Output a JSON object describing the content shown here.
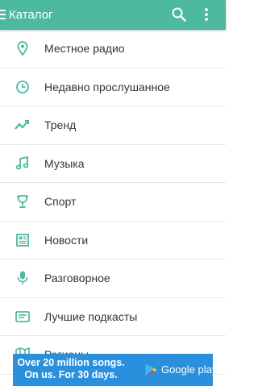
{
  "appbar": {
    "title": "Каталог",
    "icons": [
      "menu-icon",
      "search-icon",
      "more-vertical-icon"
    ],
    "color": "#4cb9a0"
  },
  "catalog": {
    "icon_color": "#4cb9a0",
    "items": [
      {
        "label": "Местное радио",
        "icon": "location-pin-icon"
      },
      {
        "label": "Недавно прослушанное",
        "icon": "clock-icon"
      },
      {
        "label": "Тренд",
        "icon": "trending-icon"
      },
      {
        "label": "Музыка",
        "icon": "music-note-icon"
      },
      {
        "label": "Спорт",
        "icon": "trophy-icon"
      },
      {
        "label": "Новости",
        "icon": "newspaper-icon"
      },
      {
        "label": "Разговорное",
        "icon": "microphone-icon"
      },
      {
        "label": "Лучшие подкасты",
        "icon": "podcast-icon"
      },
      {
        "label": "Регионы",
        "icon": "map-icon"
      }
    ]
  },
  "ad": {
    "line1": "Over 20 million songs.",
    "line2": "On us. For 30 days.",
    "store": "Google play",
    "color": "#2a8fdd"
  }
}
